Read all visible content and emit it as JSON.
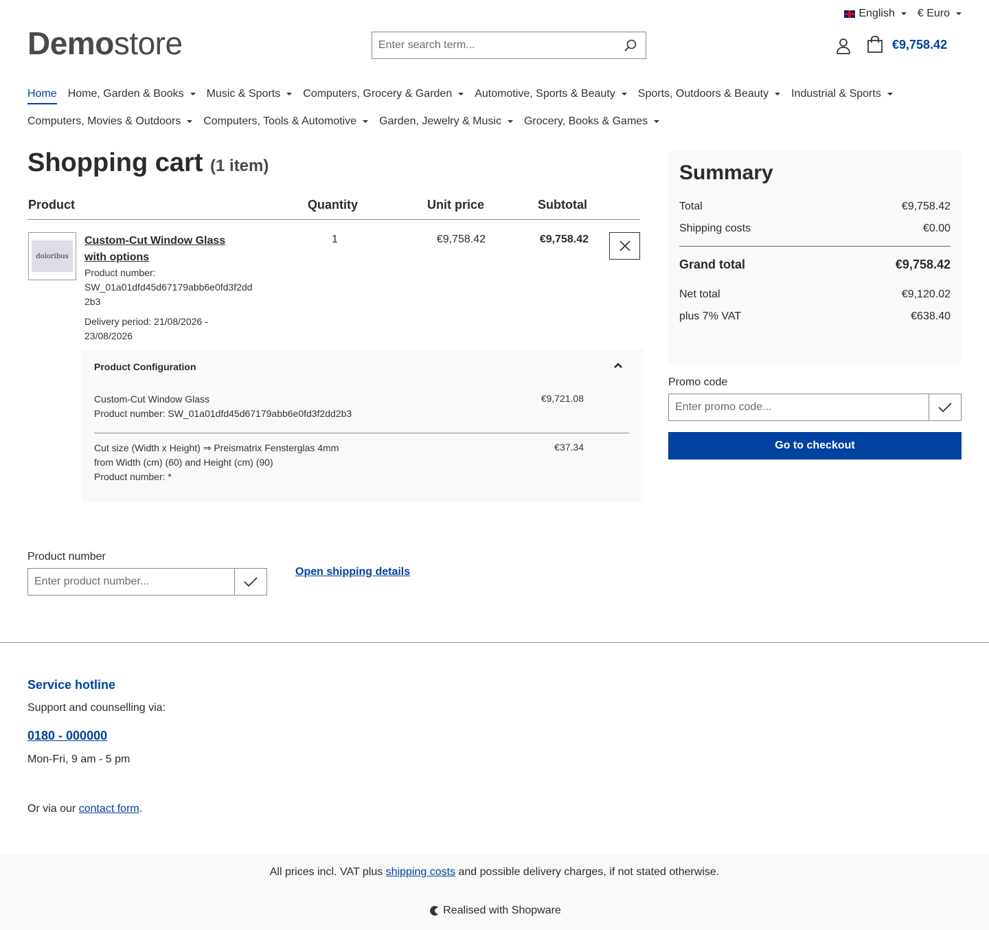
{
  "topbar": {
    "language": "English",
    "currency": "€ Euro"
  },
  "logo": {
    "bold": "Demo",
    "light": "store"
  },
  "search": {
    "placeholder": "Enter search term..."
  },
  "header": {
    "cart_total": "€9,758.42"
  },
  "nav": {
    "row1": [
      "Home",
      "Home, Garden & Books",
      "Music & Sports",
      "Computers, Grocery & Garden",
      "Automotive, Sports & Beauty",
      "Sports, Outdoors & Beauty",
      "Industrial & Sports"
    ],
    "row2": [
      "Computers, Movies & Outdoors",
      "Computers, Tools & Automotive",
      "Garden, Jewelry & Music",
      "Grocery, Books & Games"
    ]
  },
  "cart": {
    "title": "Shopping cart",
    "count": "(1 item)",
    "columns": {
      "product": "Product",
      "quantity": "Quantity",
      "unit_price": "Unit price",
      "subtotal": "Subtotal"
    },
    "item": {
      "thumb_text": "doloribus",
      "name": "Custom-Cut Window Glass with options",
      "product_number_label": "Product number:",
      "product_number": "SW_01a01dfd45d67179abb6e0fd3f2dd2b3",
      "delivery": "Delivery period: 21/08/2026 - 23/08/2026",
      "quantity": "1",
      "unit_price": "€9,758.42",
      "subtotal": "€9,758.42"
    },
    "config": {
      "title": "Product Configuration",
      "line1_name": "Custom-Cut Window Glass",
      "line1_number": "Product number: SW_01a01dfd45d67179abb6e0fd3f2dd2b3",
      "line1_price": "€9,721.08",
      "line2_a": "Cut size (Width x Height) ⇒ Preismatrix Fensterglas 4mm",
      "line2_b": "from Width (cm) (60) and Height (cm) (90)",
      "line2_number": "Product number: *",
      "line2_price": "€37.34"
    }
  },
  "summary": {
    "title": "Summary",
    "total_label": "Total",
    "total": "€9,758.42",
    "shipping_label": "Shipping costs",
    "shipping": "€0.00",
    "grand_label": "Grand total",
    "grand": "€9,758.42",
    "net_label": "Net total",
    "net": "€9,120.02",
    "vat_label": "plus 7% VAT",
    "vat": "€638.40"
  },
  "promo": {
    "label": "Promo code",
    "placeholder": "Enter promo code..."
  },
  "checkout_label": "Go to checkout",
  "product_number": {
    "label": "Product number",
    "placeholder": "Enter product number..."
  },
  "shipping_details_link": "Open shipping details",
  "footer": {
    "hotline_title": "Service hotline",
    "hotline_sub": "Support and counselling via:",
    "phone": "0180 - 000000",
    "hours": "Mon-Fri, 9 am - 5 pm",
    "contact_pre": "Or via our ",
    "contact_link": "contact form",
    "contact_post": ".",
    "vat_pre": "All prices incl. VAT plus ",
    "vat_link": "shipping costs",
    "vat_post": " and possible delivery charges, if not stated otherwise.",
    "realised": "Realised with Shopware"
  },
  "colors": {
    "accent": "#0042a0",
    "panel": "#f9f9f9"
  }
}
